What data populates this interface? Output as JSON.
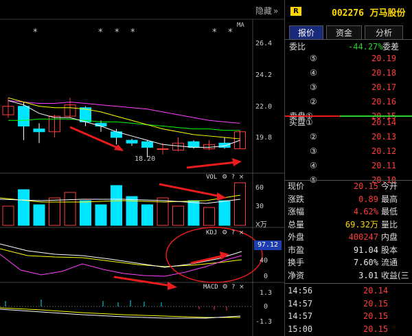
{
  "chart": {
    "hide_label": "隐藏",
    "hide_icon": "double-chevron-right",
    "ma_label": "MA",
    "star": "*",
    "price_ticks": [
      "26.4",
      "24.2",
      "22.0",
      "19.8"
    ],
    "low_label": "18.20",
    "vol_title": "VOL",
    "vol_ticks": [
      "60",
      "30"
    ],
    "vol_unit": "X万",
    "kdj_title": "KDJ",
    "kdj_value": "97.12",
    "kdj_ticks": [
      "40",
      "0"
    ],
    "macd_title": "MACD",
    "macd_ticks": [
      "1.3",
      "0",
      "-1.3"
    ],
    "gear": "⚙",
    "question": "?",
    "close": "×",
    "colors": {
      "up": "#ff3b3b",
      "down": "#00e5ff",
      "ma5": "#ffffff",
      "ma10": "#ffff00",
      "ma20": "#ff40ff",
      "ma60": "#00ff00",
      "annotation": "#e81c1c"
    },
    "candles": [
      {
        "o": 21.4,
        "c": 22.0,
        "h": 22.6,
        "l": 21.2
      },
      {
        "o": 22.0,
        "c": 20.6,
        "h": 22.3,
        "l": 19.6
      },
      {
        "o": 20.4,
        "c": 20.2,
        "h": 20.8,
        "l": 19.4
      },
      {
        "o": 20.2,
        "c": 21.3,
        "h": 21.4,
        "l": 19.8
      },
      {
        "o": 21.3,
        "c": 22.1,
        "h": 22.6,
        "l": 21.2
      },
      {
        "o": 21.9,
        "c": 20.9,
        "h": 22.0,
        "l": 20.6
      },
      {
        "o": 20.8,
        "c": 20.6,
        "h": 21.0,
        "l": 20.2
      },
      {
        "o": 20.2,
        "c": 19.8,
        "h": 20.4,
        "l": 19.3
      },
      {
        "o": 19.6,
        "c": 19.4,
        "h": 19.7,
        "l": 19.2
      },
      {
        "o": 19.5,
        "c": 19.1,
        "h": 19.6,
        "l": 18.4
      },
      {
        "o": 19.0,
        "c": 19.0,
        "h": 19.4,
        "l": 18.6
      },
      {
        "o": 18.9,
        "c": 19.4,
        "h": 19.8,
        "l": 18.8
      },
      {
        "o": 19.5,
        "c": 19.1,
        "h": 19.6,
        "l": 19.0
      },
      {
        "o": 19.0,
        "c": 19.3,
        "h": 19.6,
        "l": 18.9
      },
      {
        "o": 19.4,
        "c": 19.1,
        "h": 19.8,
        "l": 19.0
      },
      {
        "o": 19.0,
        "c": 20.2,
        "h": 20.3,
        "l": 19.0
      }
    ],
    "volume": [
      28,
      52,
      30,
      40,
      48,
      36,
      30,
      58,
      42,
      30,
      40,
      28,
      36,
      26,
      36,
      62
    ],
    "ma5_price": [
      22.4,
      22.1,
      21.5,
      21.2,
      21.2,
      20.9,
      20.6,
      20.2,
      19.9,
      19.6,
      19.3,
      19.2,
      19.1,
      19.1,
      19.2,
      19.6
    ],
    "ma10_price": [
      22.6,
      22.3,
      22.0,
      21.9,
      21.9,
      21.8,
      21.6,
      21.3,
      21.0,
      20.7,
      20.4,
      20.2,
      20.0,
      19.9,
      19.8,
      19.7
    ],
    "ma20_price": [
      22.4,
      22.3,
      22.2,
      22.2,
      22.3,
      22.2,
      22.1,
      22.0,
      21.9,
      21.8,
      21.6,
      21.4,
      21.2,
      21.0,
      20.9,
      20.8
    ],
    "ma60_price": [
      21.0,
      21.0,
      21.1,
      21.1,
      21.1,
      21.0,
      20.9,
      20.9,
      20.8,
      20.7,
      20.6,
      20.5,
      20.4,
      20.4,
      20.3,
      20.3
    ]
  },
  "quote": {
    "badge": "R",
    "code": "002276",
    "name": "万马股份",
    "tabs": [
      "报价",
      "资金",
      "分析"
    ],
    "weibi_label": "委比",
    "weibi_value": "-44.27%",
    "weicha_label": "委差",
    "sell_label": "卖盘",
    "buy_label": "买盘",
    "asks": [
      {
        "level": "⑤",
        "price": "20.19"
      },
      {
        "level": "④",
        "price": "20.18"
      },
      {
        "level": "③",
        "price": "20.17"
      },
      {
        "level": "②",
        "price": "20.16"
      },
      {
        "level": "①",
        "price": "20.15"
      }
    ],
    "bids": [
      {
        "level": "①",
        "price": "20.14"
      },
      {
        "level": "②",
        "price": "20.13"
      },
      {
        "level": "③",
        "price": "20.12"
      },
      {
        "level": "④",
        "price": "20.11"
      },
      {
        "level": "⑤",
        "price": "20.10"
      }
    ],
    "stats": [
      {
        "label": "现价",
        "value": "20.15",
        "label2": "今开",
        "color": "red"
      },
      {
        "label": "涨跌",
        "value": "0.89",
        "label2": "最高",
        "color": "red"
      },
      {
        "label": "涨幅",
        "value": "4.62%",
        "label2": "最低",
        "color": "red"
      },
      {
        "label": "总量",
        "value": "69.32万",
        "label2": "量比",
        "color": "yellow"
      },
      {
        "label": "外盘",
        "value": "400247",
        "label2": "内盘",
        "color": "red"
      },
      {
        "label": "市盈",
        "value": "91.04",
        "label2": "股本",
        "color": "white"
      },
      {
        "label": "换手",
        "value": "7.60%",
        "label2": "流通",
        "color": "white"
      },
      {
        "label": "净资",
        "value": "3.01",
        "label2": "收益(三",
        "color": "white"
      }
    ],
    "ticks": [
      {
        "time": "14:56",
        "price": "20.14"
      },
      {
        "time": "14:57",
        "price": "20.15"
      },
      {
        "time": "14:57",
        "price": "20.15"
      },
      {
        "time": "15:00",
        "price": "20.15"
      }
    ]
  }
}
